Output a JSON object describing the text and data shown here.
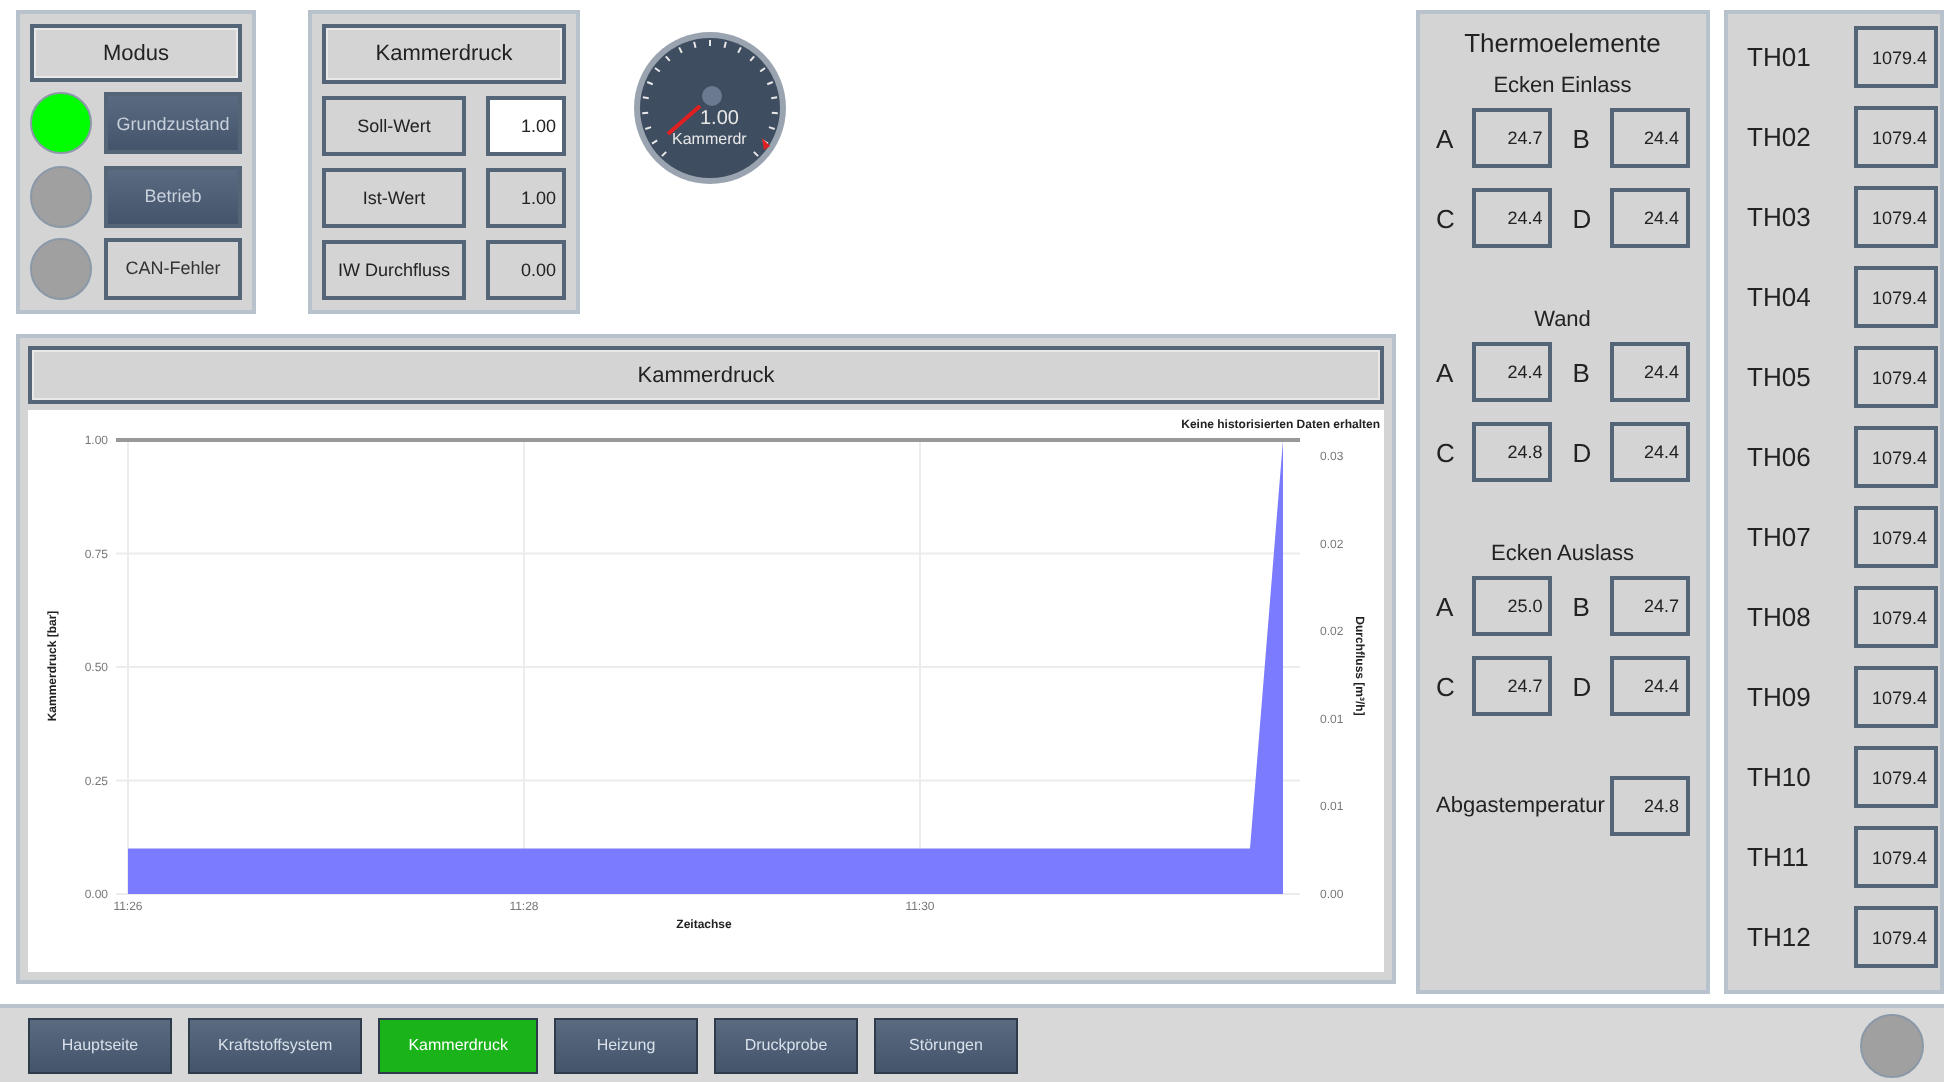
{
  "modus": {
    "title": "Modus",
    "rows": [
      {
        "label": "Grundzustand",
        "on": true,
        "highlighted": true
      },
      {
        "label": "Betrieb",
        "on": false,
        "highlighted": true
      },
      {
        "label": "CAN-Fehler",
        "on": false,
        "highlighted": false
      }
    ]
  },
  "kammerdruck": {
    "title": "Kammerdruck",
    "rows": [
      {
        "label": "Soll-Wert",
        "value": "1.00",
        "editable": true
      },
      {
        "label": "Ist-Wert",
        "value": "1.00",
        "editable": false
      },
      {
        "label": "IW Durchfluss",
        "value": "0.00",
        "editable": false
      }
    ]
  },
  "gauge": {
    "value": "1.00",
    "label": "Kammerdr"
  },
  "chart_panel": {
    "title": "Kammerdruck",
    "notice": "Keine historisierten Daten erhalten",
    "right_axis": {
      "label": "Durchfluss [m³/h]",
      "ticks": [
        "0.03",
        "0.02",
        "0.02",
        "0.01",
        "0.01",
        "0.00"
      ]
    },
    "chart_data": {
      "type": "area",
      "xlabel": "Zeitachse",
      "ylabel": "Kammerdruck [bar]",
      "categories": [
        "11:26",
        null,
        null,
        null,
        null,
        null,
        null,
        null,
        null,
        null,
        null,
        null,
        "11:28",
        null,
        null,
        null,
        null,
        null,
        null,
        null,
        null,
        null,
        null,
        null,
        "11:30",
        null,
        null,
        null,
        null,
        null,
        null,
        null,
        null,
        null,
        null,
        null
      ],
      "values": [
        0.1,
        0.1,
        0.1,
        0.1,
        0.1,
        0.1,
        0.1,
        0.1,
        0.1,
        0.1,
        0.1,
        0.1,
        0.1,
        0.1,
        0.1,
        0.1,
        0.1,
        0.1,
        0.1,
        0.1,
        0.1,
        0.1,
        0.1,
        0.1,
        0.1,
        0.1,
        0.1,
        0.1,
        0.1,
        0.1,
        0.1,
        0.1,
        0.1,
        0.1,
        0.1,
        1.0
      ],
      "ylim": [
        0,
        1
      ],
      "grid": true,
      "yticks": [
        {
          "value": 0,
          "label": "0.00"
        },
        {
          "value": 0.25,
          "label": "0.25"
        },
        {
          "value": 0.5,
          "label": "0.50"
        },
        {
          "value": 0.75,
          "label": "0.75"
        },
        {
          "value": 1,
          "label": "1.00"
        }
      ]
    }
  },
  "thermoelemente": {
    "title": "Thermoelemente",
    "groups": [
      {
        "title": "Ecken Einlass",
        "cells": [
          {
            "label": "A",
            "value": "24.7"
          },
          {
            "label": "B",
            "value": "24.4"
          },
          {
            "label": "C",
            "value": "24.4"
          },
          {
            "label": "D",
            "value": "24.4"
          }
        ]
      },
      {
        "title": "Wand",
        "cells": [
          {
            "label": "A",
            "value": "24.4"
          },
          {
            "label": "B",
            "value": "24.4"
          },
          {
            "label": "C",
            "value": "24.8"
          },
          {
            "label": "D",
            "value": "24.4"
          }
        ]
      },
      {
        "title": "Ecken Auslass",
        "cells": [
          {
            "label": "A",
            "value": "25.0"
          },
          {
            "label": "B",
            "value": "24.7"
          },
          {
            "label": "C",
            "value": "24.7"
          },
          {
            "label": "D",
            "value": "24.4"
          }
        ]
      }
    ],
    "exhaust": {
      "label": "Abgastemperatur",
      "value": "24.8"
    }
  },
  "th_list": [
    {
      "label": "TH01",
      "value": "1079.4"
    },
    {
      "label": "TH02",
      "value": "1079.4"
    },
    {
      "label": "TH03",
      "value": "1079.4"
    },
    {
      "label": "TH04",
      "value": "1079.4"
    },
    {
      "label": "TH05",
      "value": "1079.4"
    },
    {
      "label": "TH06",
      "value": "1079.4"
    },
    {
      "label": "TH07",
      "value": "1079.4"
    },
    {
      "label": "TH08",
      "value": "1079.4"
    },
    {
      "label": "TH09",
      "value": "1079.4"
    },
    {
      "label": "TH10",
      "value": "1079.4"
    },
    {
      "label": "TH11",
      "value": "1079.4"
    },
    {
      "label": "TH12",
      "value": "1079.4"
    }
  ],
  "nav": [
    {
      "label": "Hauptseite",
      "selected": false
    },
    {
      "label": "Kraftstoffsystem",
      "selected": false
    },
    {
      "label": "Kammerdruck",
      "selected": true
    },
    {
      "label": "Heizung",
      "selected": false
    },
    {
      "label": "Druckprobe",
      "selected": false
    },
    {
      "label": "Störungen",
      "selected": false
    }
  ]
}
